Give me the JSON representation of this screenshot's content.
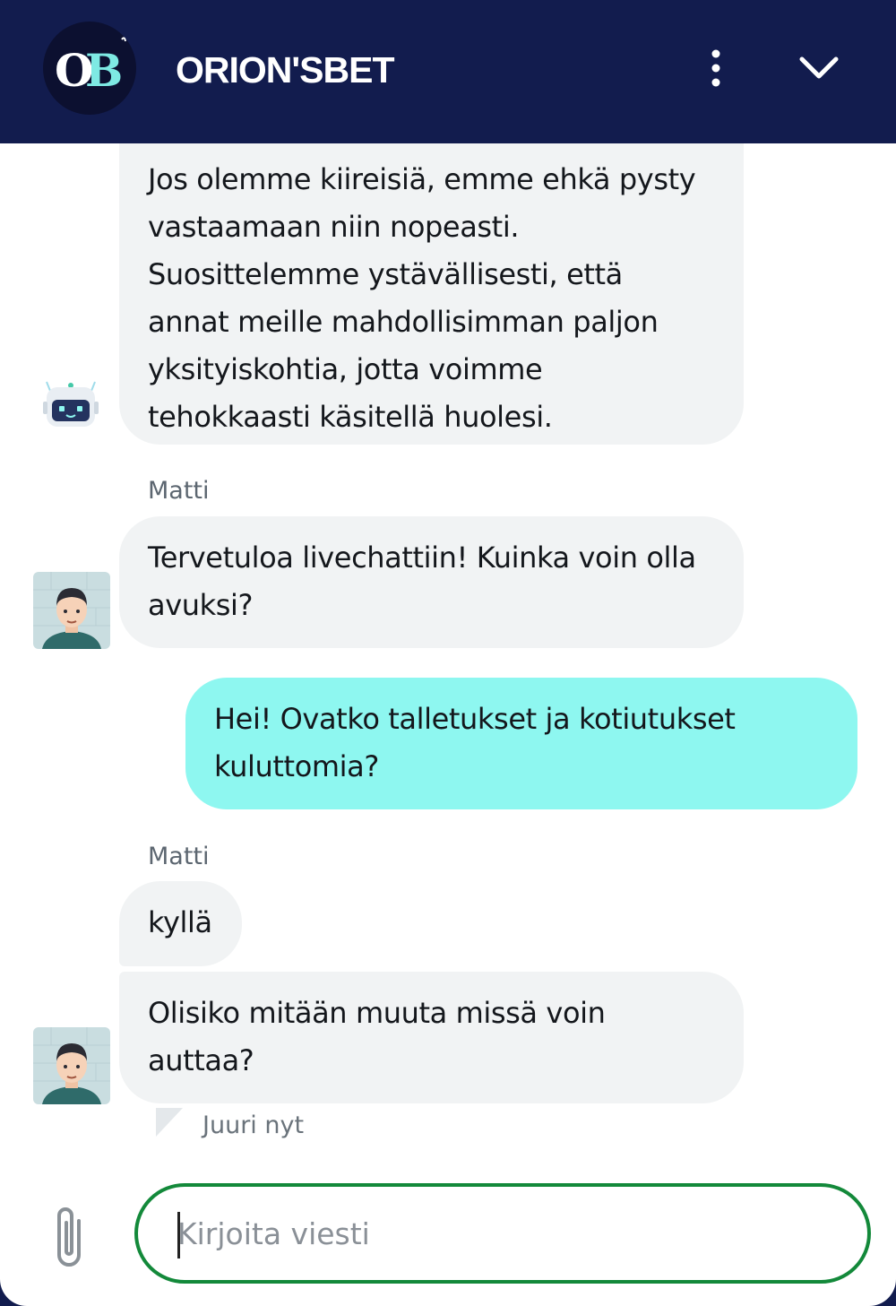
{
  "header": {
    "logo_text": "OB",
    "brand_name": "ORION'SBET",
    "menu_icon": "vertical-dots-icon",
    "collapse_icon": "chevron-down-icon"
  },
  "messages": [
    {
      "role": "bot",
      "lines": [
        "Jos olemme kiireisiä, emme ehkä pysty",
        "vastaamaan niin nopeasti.",
        "Suosittelemme ystävällisesti, että",
        "annat meille mahdollisimman paljon",
        "yksityiskohtia, jotta voimme",
        "tehokkaasti käsitellä huolesi."
      ]
    },
    {
      "role": "agent",
      "sender": "Matti",
      "lines": [
        "Tervetuloa livechattiin! Kuinka voin olla",
        "avuksi?"
      ]
    },
    {
      "role": "user",
      "lines": [
        "Hei! Ovatko talletukset ja kotiutukset",
        "kuluttomia?"
      ]
    },
    {
      "role": "agent",
      "sender": "Matti",
      "lines": [
        "kyllä"
      ]
    },
    {
      "role": "agent",
      "lines": [
        "Olisiko mitään muuta missä voin",
        "auttaa?"
      ]
    }
  ],
  "timestamp": "Juuri nyt",
  "composer": {
    "attach_icon": "paperclip-icon",
    "placeholder": "Kirjoita viesti",
    "value": ""
  },
  "colors": {
    "header_bg": "#121c4e",
    "agent_bubble": "#f1f3f4",
    "user_bubble": "#8ef7f0",
    "input_border": "#13893a",
    "logo_accent": "#7ee9e3"
  }
}
